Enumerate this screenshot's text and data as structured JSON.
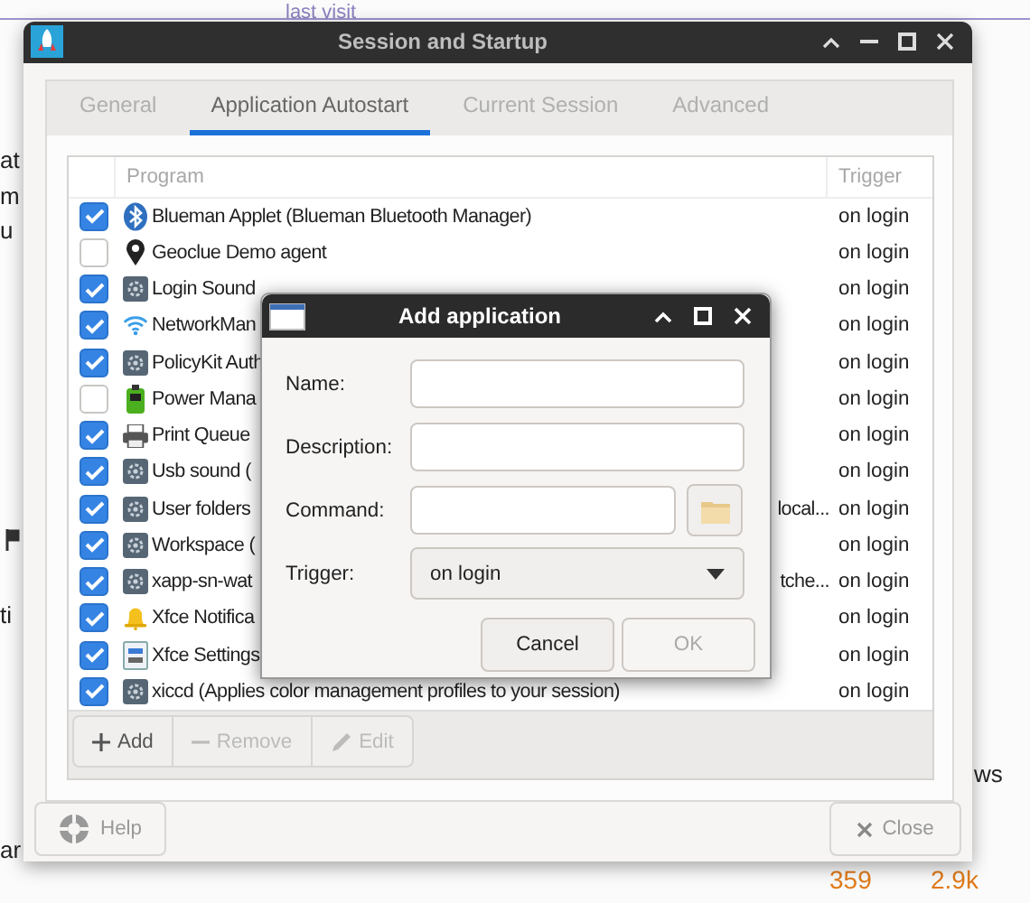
{
  "background": {
    "link": "last visit",
    "fragments": [
      {
        "text": "at"
      },
      {
        "text": "m"
      },
      {
        "text": "u"
      },
      {
        "text": "ti"
      },
      {
        "text": "ar"
      },
      {
        "text": "ws"
      }
    ],
    "counts": [
      "359",
      "2.9k"
    ]
  },
  "window": {
    "title": "Session and Startup",
    "tabs": [
      {
        "label": "General",
        "selected": false
      },
      {
        "label": "Application Autostart",
        "selected": true
      },
      {
        "label": "Current Session",
        "selected": false
      },
      {
        "label": "Advanced",
        "selected": false
      }
    ],
    "columns": [
      "Program",
      "Trigger"
    ],
    "rows": [
      {
        "checked": true,
        "program": "Blueman Applet (Blueman Bluetooth Manager)",
        "trigger": "on login"
      },
      {
        "checked": false,
        "program": "Geoclue Demo agent",
        "trigger": "on login"
      },
      {
        "checked": true,
        "program": "Login Sound",
        "trigger": "on login"
      },
      {
        "checked": true,
        "program": "NetworkMan",
        "trigger": "on login"
      },
      {
        "checked": true,
        "program": "PolicyKit Auth",
        "trigger": "on login"
      },
      {
        "checked": false,
        "program": "Power Mana",
        "trigger": "on login"
      },
      {
        "checked": true,
        "program": "Print Queue",
        "trigger": "on login"
      },
      {
        "checked": true,
        "program": "Usb sound (",
        "trigger": "on login"
      },
      {
        "checked": true,
        "program": "User folders",
        "program_tail": "local...",
        "trigger": "on login"
      },
      {
        "checked": true,
        "program": "Workspace (",
        "trigger": "on login"
      },
      {
        "checked": true,
        "program": "xapp-sn-wat",
        "program_tail": "tche...",
        "trigger": "on login"
      },
      {
        "checked": true,
        "program": "Xfce Notifica",
        "trigger": "on login"
      },
      {
        "checked": true,
        "program": "Xfce Settings",
        "trigger": "on login"
      },
      {
        "checked": true,
        "program": "xiccd (Applies color management profiles to your session)",
        "trigger": "on login"
      }
    ],
    "toolbar": [
      {
        "label": "Add",
        "disabled": false
      },
      {
        "label": "Remove",
        "disabled": true
      },
      {
        "label": "Edit",
        "disabled": true
      }
    ],
    "help": "Help",
    "close": "Close"
  },
  "dialog": {
    "title": "Add application",
    "fields": [
      {
        "label": "Name:",
        "kind": "text"
      },
      {
        "label": "Description:",
        "kind": "text"
      },
      {
        "label": "Command:",
        "kind": "file"
      },
      {
        "label": "Trigger:",
        "kind": "combo",
        "value": "on login"
      }
    ],
    "buttons": [
      {
        "label": "Cancel",
        "disabled": false
      },
      {
        "label": "OK",
        "disabled": true
      }
    ]
  }
}
